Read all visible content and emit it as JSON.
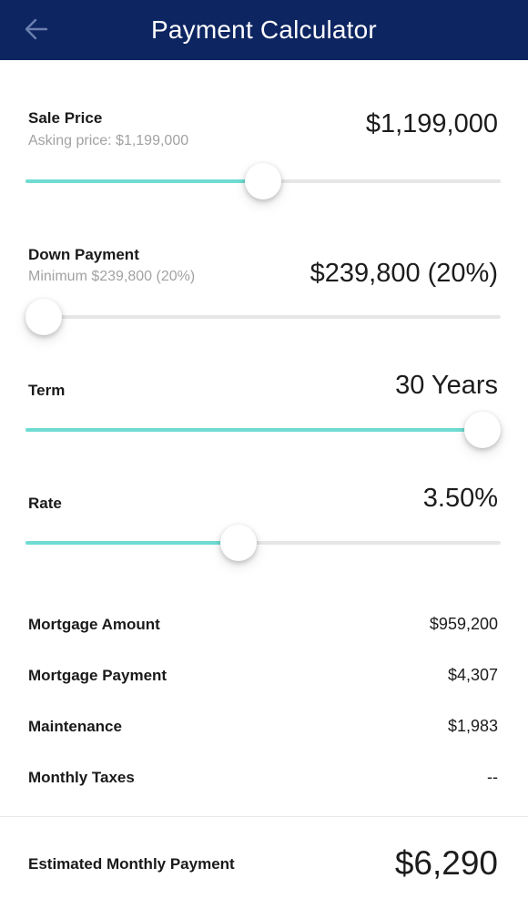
{
  "header": {
    "title": "Payment Calculator",
    "back_icon": "arrow-left-icon",
    "background_color": "#0d2561"
  },
  "accent_color": "#6fdcd2",
  "sale_price": {
    "label": "Sale Price",
    "sublabel": "Asking price: $1,199,000",
    "value": "$1,199,000",
    "slider_fraction": 0.5
  },
  "down_payment": {
    "label": "Down Payment",
    "sublabel": "Minimum $239,800 (20%)",
    "value": "$239,800 (20%)",
    "slider_fraction": 0.0
  },
  "term": {
    "label": "Term",
    "value": "30 Years",
    "slider_fraction": 1.0
  },
  "rate": {
    "label": "Rate",
    "value": "3.50%",
    "slider_fraction": 0.445
  },
  "summary": [
    {
      "label": "Mortgage Amount",
      "value": "$959,200"
    },
    {
      "label": "Mortgage Payment",
      "value": "$4,307"
    },
    {
      "label": "Maintenance",
      "value": "$1,983"
    },
    {
      "label": "Monthly Taxes",
      "value": "--"
    }
  ],
  "footer": {
    "label": "Estimated Monthly Payment",
    "value": "$6,290"
  }
}
